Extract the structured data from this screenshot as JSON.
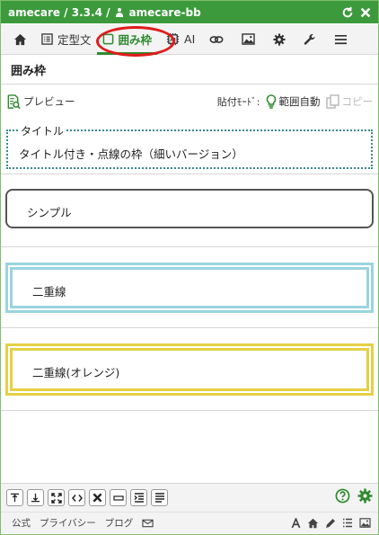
{
  "titlebar": {
    "title": "amecare / 3.3.4 /",
    "user": "amecare-bb",
    "icons": [
      "refresh-icon",
      "close-icon"
    ]
  },
  "tabs": [
    {
      "id": "home",
      "label": "",
      "icon": "home-icon"
    },
    {
      "id": "teikei",
      "label": "定型文",
      "icon": "list-icon"
    },
    {
      "id": "kakomi",
      "label": "囲み枠",
      "icon": "square-icon",
      "active": true
    },
    {
      "id": "ai",
      "label": "AI",
      "icon": "ai-chip-icon"
    },
    {
      "id": "link",
      "label": "",
      "icon": "link-icon"
    },
    {
      "id": "image",
      "label": "",
      "icon": "image-icon"
    },
    {
      "id": "settings",
      "label": "",
      "icon": "gear-icon"
    },
    {
      "id": "tools",
      "label": "",
      "icon": "wrench-icon"
    },
    {
      "id": "menu",
      "label": "",
      "icon": "hamburger-icon"
    }
  ],
  "section": {
    "title": "囲み枠"
  },
  "toolbar": {
    "preview": "プレビュー",
    "paste_mode": "貼付ﾓｰﾄﾞ:",
    "range_auto": "範囲自動",
    "copy": "コピー"
  },
  "samples": {
    "dotted": {
      "legend": "タイトル",
      "body": "タイトル付き・点線の枠（細いバージョン）"
    },
    "simple": {
      "label": "シンプル"
    },
    "double": {
      "label": "二重線"
    },
    "double_orange": {
      "label": "二重線(オレンジ)"
    }
  },
  "bottom_icons": [
    "align-top-icon",
    "align-bottom-icon",
    "expand-icon",
    "code-icon",
    "delete-icon",
    "hr-icon",
    "indent-icon",
    "justify-icon"
  ],
  "footer": {
    "links": [
      "公式",
      "プライバシー",
      "ブログ"
    ],
    "icons": [
      "mail-icon",
      "font-icon",
      "home-icon",
      "pen-icon",
      "list-icon",
      "image-icon"
    ]
  },
  "colors": {
    "brand_green": "#3c9a3c",
    "annotation_red": "#e01b1b",
    "dotted_teal": "#3a8a8a",
    "double_blue": "#9ad4de",
    "double_orange": "#e5d045"
  }
}
